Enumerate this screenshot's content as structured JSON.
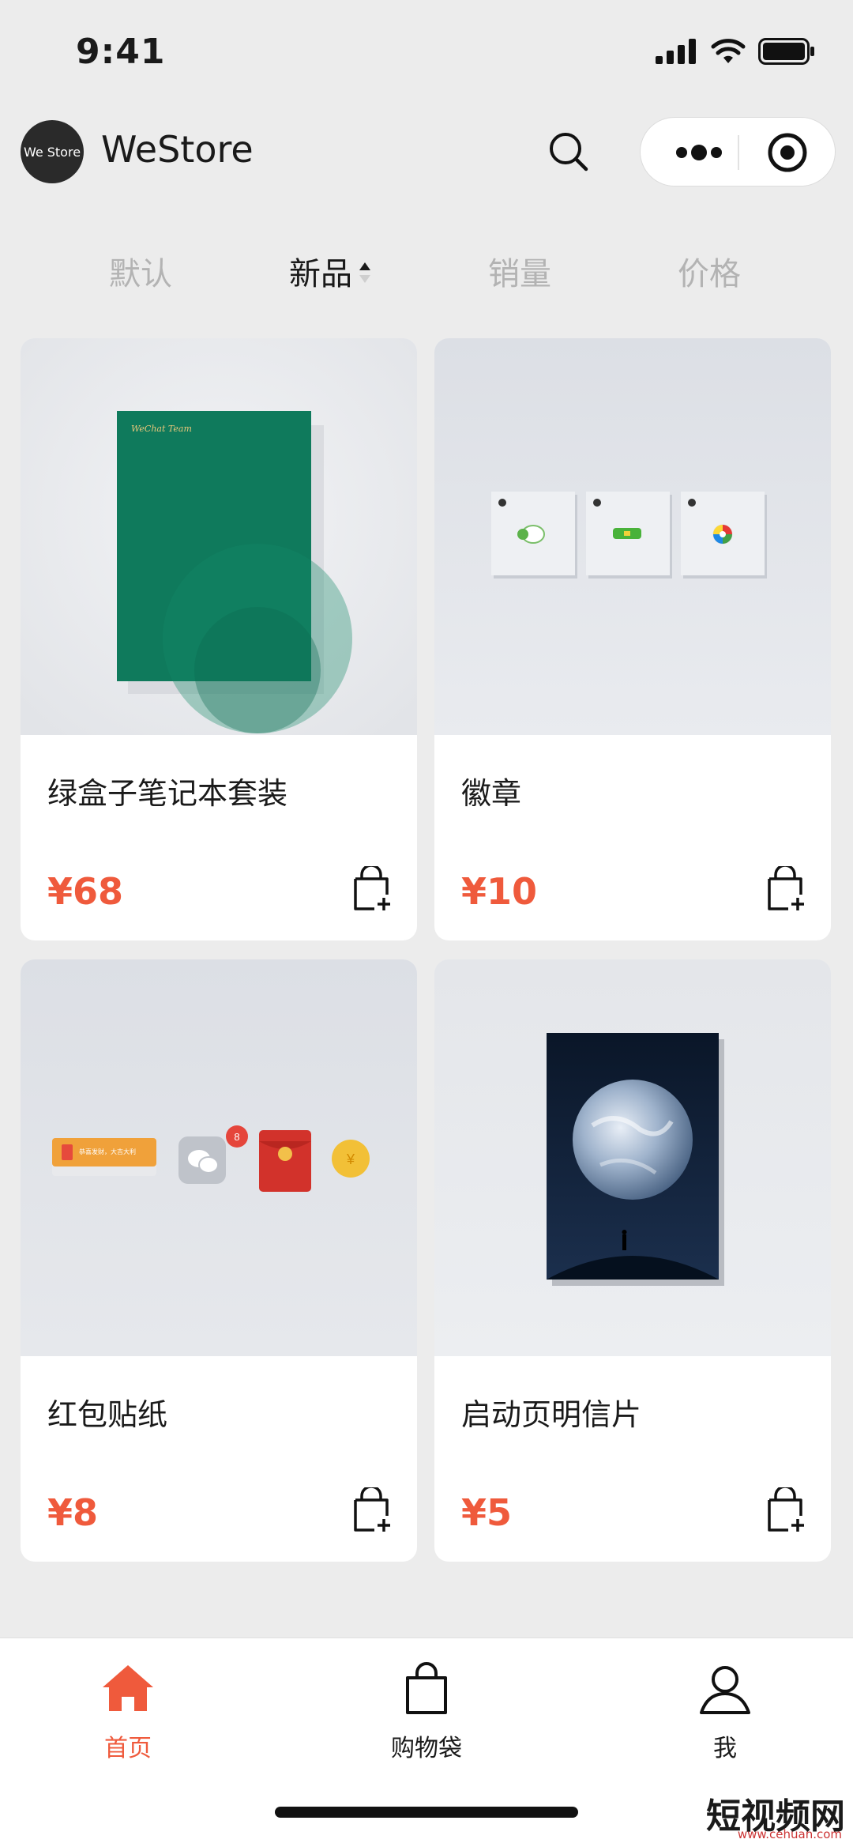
{
  "status_bar": {
    "time": "9:41",
    "icons": [
      "signal-icon",
      "wifi-icon",
      "battery-icon"
    ]
  },
  "header": {
    "logo_text": "We Store",
    "title": "WeStore",
    "search_icon": "search-icon",
    "capsule": {
      "more_icon": "more-dots-icon",
      "close_icon": "record-circle-icon"
    }
  },
  "sort_tabs": [
    {
      "label": "默认",
      "active": false
    },
    {
      "label": "新品",
      "active": true,
      "sort": "ascending"
    },
    {
      "label": "销量",
      "active": false
    },
    {
      "label": "价格",
      "active": false
    }
  ],
  "products": [
    {
      "name": "绿盒子笔记本套装",
      "price": "¥68",
      "image": "green-notebook-box",
      "box_lettering": "WeChat Team"
    },
    {
      "name": "徽章",
      "price": "¥10",
      "image": "three-badges"
    },
    {
      "name": "红包贴纸",
      "price": "¥8",
      "image": "red-packet-stickers",
      "badge_count": "8",
      "card_text": "恭喜发财，大吉大利"
    },
    {
      "name": "启动页明信片",
      "price": "¥5",
      "image": "earth-postcard"
    }
  ],
  "tab_bar": [
    {
      "label": "首页",
      "icon": "home-icon",
      "active": true
    },
    {
      "label": "购物袋",
      "icon": "shopping-bag-icon",
      "active": false
    },
    {
      "label": "我",
      "icon": "user-icon",
      "active": false
    }
  ],
  "colors": {
    "accent": "#ef5a3c",
    "background": "#ececec",
    "card": "#ffffff",
    "muted_text": "#b3b3b3"
  },
  "watermark": {
    "text": "短视频网",
    "sub": "www.cehuan.com"
  }
}
